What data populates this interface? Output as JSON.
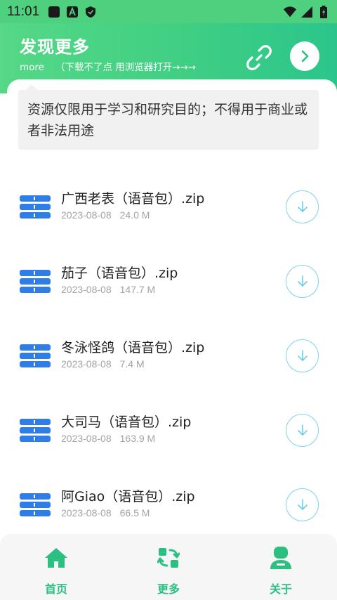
{
  "status_bar": {
    "time": "11:01"
  },
  "header": {
    "title": "发现更多",
    "subtitle_more": "more",
    "subtitle_hint": "（下载不了点 用浏览器打开→→→"
  },
  "notice": {
    "text": "资源仅限用于学习和研究目的；不得用于商业或者非法用途"
  },
  "files": [
    {
      "name": "广西老表（语音包）.zip",
      "date": "2023-08-08",
      "size": "24.0 M"
    },
    {
      "name": "茄子（语音包）.zip",
      "date": "2023-08-08",
      "size": "147.7 M"
    },
    {
      "name": "冬泳怪鸽（语音包）.zip",
      "date": "2023-08-08",
      "size": "7.4 M"
    },
    {
      "name": "大司马（语音包）.zip",
      "date": "2023-08-08",
      "size": "163.9 M"
    },
    {
      "name": "阿Giao（语音包）.zip",
      "date": "2023-08-08",
      "size": "66.5 M"
    }
  ],
  "bottom_nav": {
    "items": [
      {
        "label": "首页",
        "icon": "home-icon"
      },
      {
        "label": "更多",
        "icon": "refresh-icon"
      },
      {
        "label": "关于",
        "icon": "user-icon"
      }
    ]
  },
  "colors": {
    "accent_green": "#2bbf82",
    "header_green": "#3fcf83",
    "file_icon_blue": "#2f7ee8",
    "download_ring": "#7fd3ea"
  }
}
